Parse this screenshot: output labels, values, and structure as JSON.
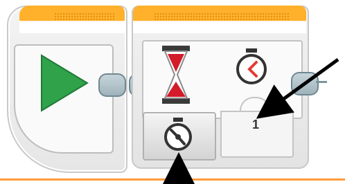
{
  "blocks": {
    "start": {},
    "wait": {
      "time_value": "1"
    }
  },
  "colors": {
    "block_header": "#ffb12b",
    "start_triangle": "#2fa24a",
    "hourglass_sand": "#d31b2a",
    "timer_accent": "#e43a31",
    "plug": "#9fb3bb",
    "accent_line": "#ff9b3a",
    "arrow": "#000000"
  },
  "icons": {
    "start": "play-triangle-icon",
    "wait": "hourglass-icon",
    "time_parameter": "stopwatch-icon",
    "mode_selector": "stopwatch-mode-icon"
  }
}
